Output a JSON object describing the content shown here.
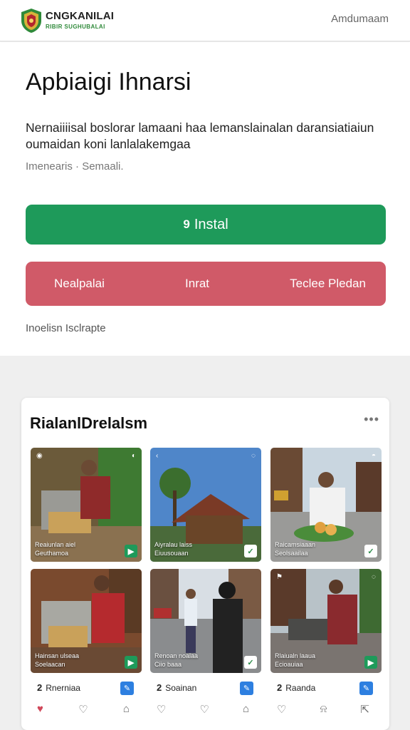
{
  "header": {
    "brand_name": "CNGKANILAI",
    "brand_sub": "RIBIR SUGHUBALAI",
    "right_link": "Amdumaam"
  },
  "app": {
    "title": "Apbiaigi Ihnarsi",
    "description": "Nernaiiiisal boslorar lamaani haa lemanslainalan daransiatiaiun oumaidan koni lanlalakemgaa",
    "meta": "Imenearis · Semaali."
  },
  "buttons": {
    "install_icon": "9",
    "install_label": "Instal",
    "row": [
      "Nealpalai",
      "Inrat",
      "Teclee Pledan"
    ]
  },
  "small_link": "Inoelisn Isclrapte",
  "gallery": {
    "title": "RialanlDrelalsm",
    "more": "•••",
    "tiles": [
      {
        "caption1": "Reaiunlan aiel",
        "caption2": "Geuthamoa"
      },
      {
        "caption1": "Aiyralau laiss",
        "caption2": "Eiuusouaan"
      },
      {
        "caption1": "Raicamsiaaan",
        "caption2": "Seolsaailaa"
      },
      {
        "caption1": "Hainsan ulseaa",
        "caption2": "Soelaacan"
      },
      {
        "caption1": "Renoan noalaa",
        "caption2": "Ciio baaa"
      },
      {
        "caption1": "Rlaiualn laaua",
        "caption2": "Ecioauiaa"
      }
    ],
    "authors": [
      "Rnerniaa",
      "Soainan",
      "Raanda"
    ],
    "author_prefix": [
      "2",
      "2",
      "2"
    ]
  },
  "colors": {
    "install_green": "#1e9a5a",
    "row_red": "#d05a68",
    "edit_blue": "#2d7fe0"
  }
}
